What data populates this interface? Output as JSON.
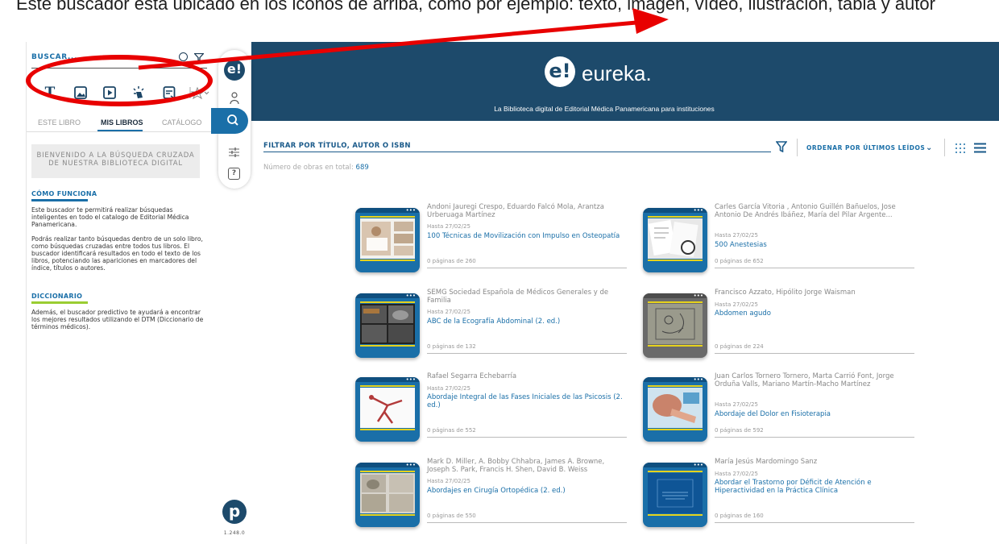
{
  "caption": "Este buscador está ubicado en los iconos de arriba, como por ejemplo: texto, imagen, vídeo, ilustración, tabla y autor",
  "left_panel": {
    "search_label": "BUSCAR...",
    "tabs": [
      "ESTE LIBRO",
      "MIS LIBROS",
      "CATÁLOGO"
    ],
    "welcome": "BIENVENIDO A LA BÚSQUEDA CRUZADA DE NUESTRA BIBLIOTECA DIGITAL",
    "how_title": "CÓMO FUNCIONA",
    "how_text_1": "Este buscador te permitirá realizar búsquedas inteligentes en todo el catalogo de Editorial Médica Panamericana.",
    "how_text_2": "Podrás realizar tanto búsquedas dentro de un solo libro, como búsquedas cruzadas entre todos tus libros. El buscador identificará resultados en todo el texto de los libros, potenciando las apariciones en marcadores del índice, títulos o autores.",
    "dict_title": "DICCIONARIO",
    "dict_text": "Además, el buscador predictivo te ayudará a encontrar los mejores resultados utilizando el DTM (Diccionario de términos médicos)."
  },
  "rail": {
    "version": "1.248.0",
    "help": "?"
  },
  "header": {
    "brand": "eureka.",
    "subtitle": "La Biblioteca digital de Editorial Médica Panamericana para instituciones"
  },
  "toolbar": {
    "filter_label": "FILTRAR POR TÍTULO, AUTOR O ISBN",
    "sort_label": "ORDENAR POR ÚLTIMOS LEÍDOS",
    "total_label": "Número de obras en total:",
    "total_value": "689"
  },
  "books": [
    {
      "authors": "Andoni Jauregi Crespo, Eduardo Falcó Mola, Arantza Urberuaga Martínez",
      "date": "Hasta 27/02/25",
      "title": "100 Técnicas de Movilización con Impulso en Osteopatía",
      "pages": "0 páginas de 260"
    },
    {
      "authors": "Carles García Vitoria , Antonio Guillén Bañuelos, Jose Antonio De Andrés Ibáñez, María del Pilar Argente...",
      "date": "Hasta 27/02/25",
      "title": "500 Anestesias",
      "pages": "0 páginas de 652"
    },
    {
      "authors": "SEMG Sociedad Española de Médicos Generales y de Familia",
      "date": "Hasta 27/02/25",
      "title": "ABC de la Ecografía Abdominal (2. ed.)",
      "pages": "0 páginas de 132"
    },
    {
      "authors": "Francisco Azzato, Hipólito Jorge Waisman",
      "date": "Hasta 27/02/25",
      "title": "Abdomen agudo",
      "pages": "0 páginas de 224"
    },
    {
      "authors": "Rafael Segarra Echebarría",
      "date": "Hasta 27/02/25",
      "title": "Abordaje Integral de las Fases Iniciales de las Psicosis (2. ed.)",
      "pages": "0 páginas de 552"
    },
    {
      "authors": "Juan Carlos Tornero Tornero, Marta Carrió Font, Jorge Orduña Valls, Mariano Martín-Macho Martínez",
      "date": "Hasta 27/02/25",
      "title": "Abordaje del Dolor en Fisioterapia",
      "pages": "0 páginas de 592"
    },
    {
      "authors": "Mark D. Miller, A. Bobby Chhabra, James A. Browne, Joseph S. Park, Francis H. Shen, David B. Weiss",
      "date": "Hasta 27/02/25",
      "title": "Abordajes en Cirugía Ortopédica (2. ed.)",
      "pages": "0 páginas de 550"
    },
    {
      "authors": "María Jesús Mardomingo Sanz",
      "date": "Hasta 27/02/25",
      "title": "Abordar el Trastorno por Déficit de Atención e Hiperactividad en la Práctica Clínica",
      "pages": "0 páginas de 160"
    }
  ],
  "colors": {
    "brand": "#1d4a6b",
    "accent": "#1a6fa8",
    "annotation": "#e80000",
    "highlight": "#e6d21c"
  }
}
